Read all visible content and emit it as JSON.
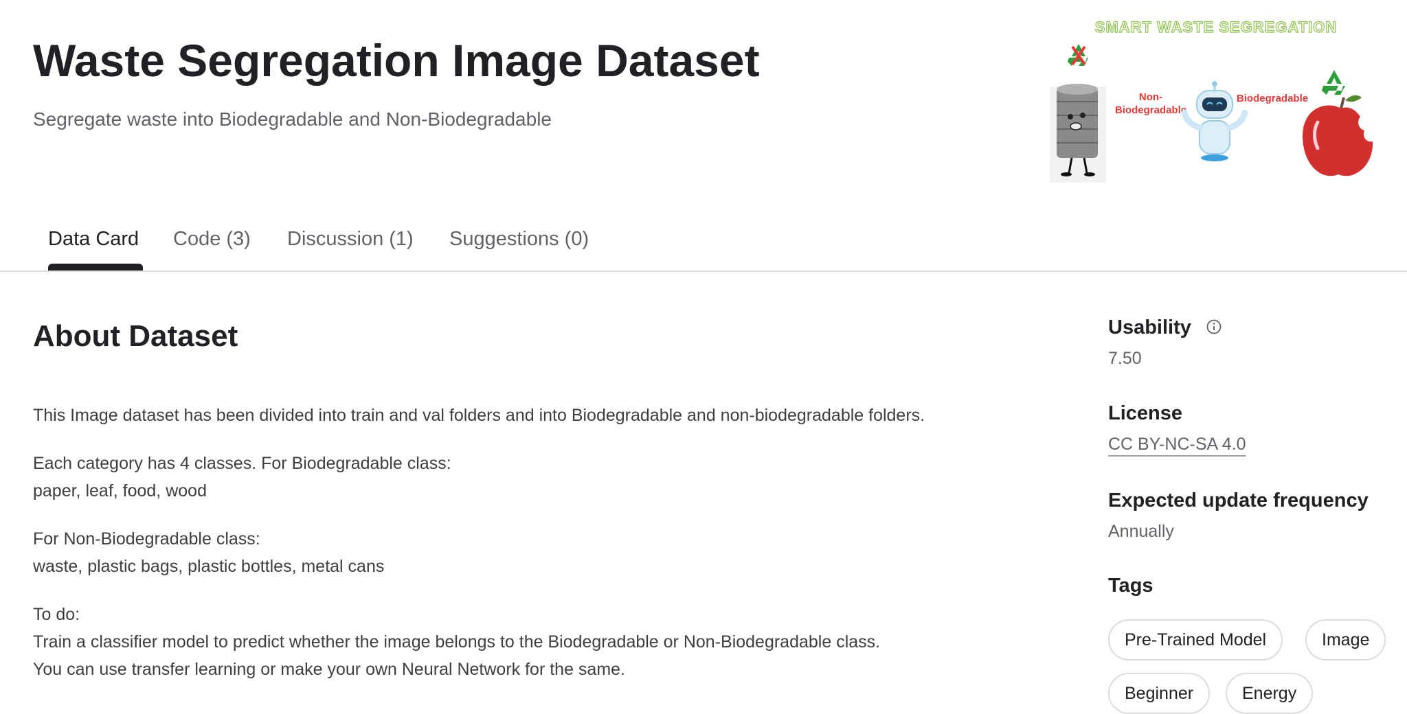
{
  "header": {
    "title": "Waste Segregation Image Dataset",
    "subtitle": "Segregate waste into Biodegradable and Non-Biodegradable"
  },
  "banner": {
    "heading": "SMART WASTE SEGREGATION",
    "left_label_line1": "Non-",
    "left_label_line2": "Biodegradable",
    "right_label": "Biodegradable"
  },
  "tabs": [
    {
      "label": "Data Card",
      "active": true
    },
    {
      "label": "Code (3)"
    },
    {
      "label": "Discussion (1)"
    },
    {
      "label": "Suggestions (0)"
    }
  ],
  "about": {
    "title": "About Dataset",
    "paragraphs": [
      "This Image dataset has been divided into train and val folders and into Biodegradable and non-biodegradable folders.",
      "Each category has 4 classes. For Biodegradable class:",
      "paper, leaf, food, wood",
      "For Non-Biodegradable class:",
      "waste, plastic bags, plastic bottles, metal cans",
      "To do:",
      "Train a classifier model to predict whether the image belongs to the Biodegradable or Non-Biodegradable class.",
      "You can use transfer learning or make your own Neural Network for the same."
    ]
  },
  "sidebar": {
    "usability_label": "Usability",
    "usability_value": "7.50",
    "license_label": "License",
    "license_value": "CC BY-NC-SA 4.0",
    "frequency_label": "Expected update frequency",
    "frequency_value": "Annually",
    "tags_label": "Tags",
    "tags": [
      "Pre-Trained Model",
      "Image",
      "Beginner",
      "Energy"
    ]
  },
  "colors": {
    "text_primary": "#202124",
    "text_secondary": "#5f6368",
    "banner_heading": "#8bc34a",
    "banner_label": "#e53935",
    "recycle_green": "#2e9e3a"
  },
  "icons": [
    "info-icon",
    "recycle-icon",
    "robot-icon",
    "tin-can-icon",
    "apple-icon"
  ]
}
